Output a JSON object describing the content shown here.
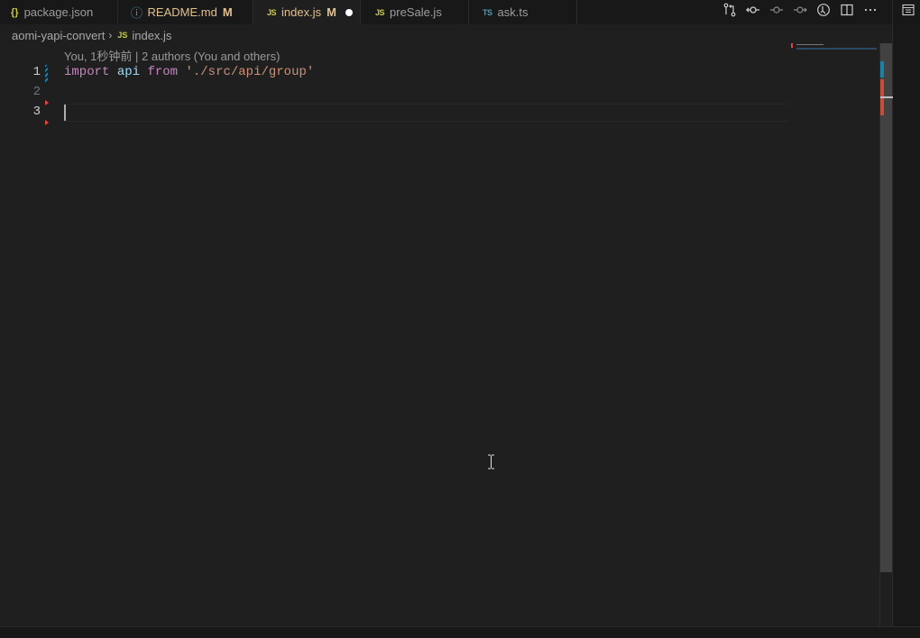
{
  "tabs": [
    {
      "icon_text": "{}",
      "icon_name": "json-file-icon",
      "icon_color": "#cbcb41",
      "label": "package.json",
      "modified": "",
      "dirty": false,
      "active": false
    },
    {
      "icon_text": "ⓘ",
      "icon_name": "info-file-icon",
      "icon_color": "#519aba",
      "label": "README.md",
      "modified": "M",
      "dirty": false,
      "active": false
    },
    {
      "icon_text": "JS",
      "icon_name": "js-file-icon",
      "icon_color": "#cbcb41",
      "label": "index.js",
      "modified": "M",
      "dirty": true,
      "active": true
    },
    {
      "icon_text": "JS",
      "icon_name": "js-file-icon",
      "icon_color": "#cbcb41",
      "label": "preSale.js",
      "modified": "",
      "dirty": false,
      "active": false
    },
    {
      "icon_text": "TS",
      "icon_name": "ts-file-icon",
      "icon_color": "#519aba",
      "label": "ask.ts",
      "modified": "",
      "dirty": false,
      "active": false
    }
  ],
  "toolbar_icons": [
    "open-changes-icon",
    "git-compare-icon",
    "previous-change-icon",
    "next-change-icon",
    "timeline-icon",
    "split-editor-icon",
    "more-actions-icon"
  ],
  "breadcrumb": {
    "folder": "aomi-yapi-convert",
    "file_icon_text": "JS",
    "file": "index.js"
  },
  "editor": {
    "codelens": "You, 1秒钟前 | 2 authors (You and others)",
    "line_numbers": [
      "1",
      "2",
      "3"
    ],
    "code_line_1": {
      "kw_import": "import",
      "ident": "api",
      "kw_from": "from",
      "string": "'./src/api/group'"
    },
    "active_line": "3"
  },
  "colors": {
    "accent_blue": "#1b81a8",
    "deleted_red": "#e0443e",
    "keyword": "#c586c0",
    "identifier": "#9cdcfe",
    "string": "#ce9178",
    "modified_tab": "#e2c08d"
  }
}
